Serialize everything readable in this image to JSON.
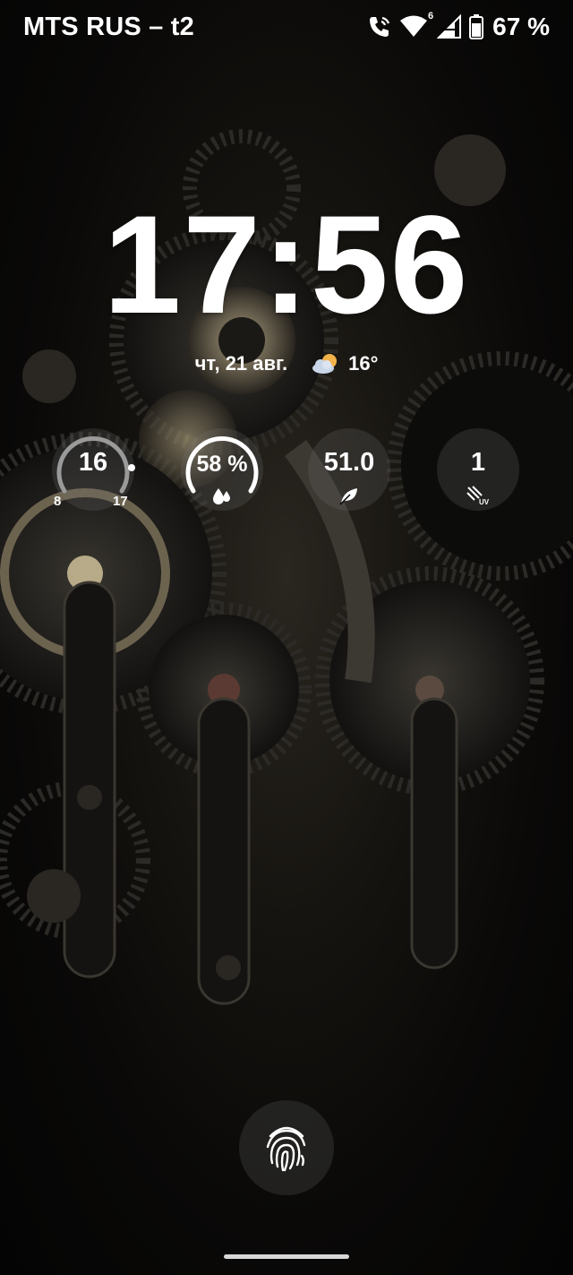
{
  "status_bar": {
    "carrier": "MTS RUS – t2",
    "network_badge": "6",
    "battery_percent": "67 %",
    "icons": [
      "wifi-calling-icon",
      "wifi-icon",
      "signal-icon",
      "battery-icon"
    ]
  },
  "lockscreen": {
    "time": "17:56",
    "date": "чт, 21 авг.",
    "weather": {
      "icon": "partly-cloudy-icon",
      "temperature": "16°"
    }
  },
  "complications": {
    "temperature": {
      "value": "16",
      "min": "8",
      "max": "17"
    },
    "humidity": {
      "value": "58 %",
      "icon": "droplets-icon",
      "level": 0.58
    },
    "air_quality": {
      "value": "51.0",
      "icon": "leaf-icon"
    },
    "uv_index": {
      "value": "1",
      "icon": "uv-icon"
    }
  },
  "colors": {
    "text": "#ffffff",
    "complication_bg": "#7a7a7a",
    "gauge_track": "#9a9a9a"
  },
  "unlock": {
    "icon": "fingerprint-icon"
  }
}
